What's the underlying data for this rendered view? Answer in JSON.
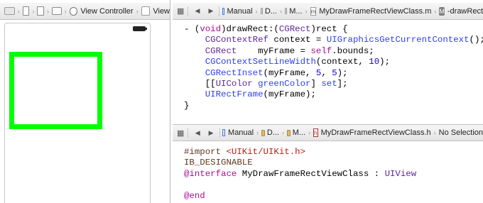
{
  "left_jumpbar": {
    "view_controller_label": "View Controller",
    "view_label": "View"
  },
  "top_editor": {
    "jumpbar": {
      "manual": "Manual",
      "d_group": "D...",
      "m_group": "M...",
      "file": "MyDrawFrameRectViewClass.m",
      "method_badge": "M",
      "method": "-drawRect"
    },
    "code": {
      "l1_a": "- (",
      "l1_void": "void",
      "l1_b": ")drawRect:(",
      "l1_cgrect": "CGRect",
      "l1_c": ")rect {",
      "l2_type": "CGContextRef",
      "l2_a": " context = ",
      "l2_fn": "UIGraphicsGetCurrentContext",
      "l2_b": "();",
      "l3_type": "CGRect",
      "l3_a": "    myFrame = ",
      "l3_self": "self",
      "l3_b": ".bounds;",
      "l4_fn": "CGContextSetLineWidth",
      "l4_a": "(context, ",
      "l4_num": "10",
      "l4_b": ");",
      "l5_fn": "CGRectInset",
      "l5_a": "(myFrame, ",
      "l5_n1": "5",
      "l5_b": ", ",
      "l5_n2": "5",
      "l5_c": ");",
      "l6_a": "[[",
      "l6_type": "UIColor",
      "l6_b": " ",
      "l6_fn": "greenColor",
      "l6_c": "] ",
      "l6_fn2": "set",
      "l6_d": "];",
      "l7_fn": "UIRectFrame",
      "l7_a": "(myFrame);",
      "l8": "}"
    }
  },
  "bottom_editor": {
    "jumpbar": {
      "manual": "Manual",
      "d_group": "D...",
      "m_group": "M...",
      "file": "MyDrawFrameRectViewClass.h",
      "selection": "No Selection"
    },
    "code": {
      "l1_import": "#import",
      "l1_space": " ",
      "l1_str": "<UIKit/UIKit.h>",
      "l2": "IB_DESIGNABLE",
      "l3_kw": "@interface",
      "l3_a": " MyDrawFrameRectViewClass : ",
      "l3_type": "UIView",
      "l4_end": "@end"
    }
  },
  "colors": {
    "frame_green": "#00ff00",
    "keyword": "#aa0d91",
    "type": "#5c2699",
    "function": "#2e3ef0",
    "number": "#1c00cf",
    "string": "#c41a16"
  }
}
